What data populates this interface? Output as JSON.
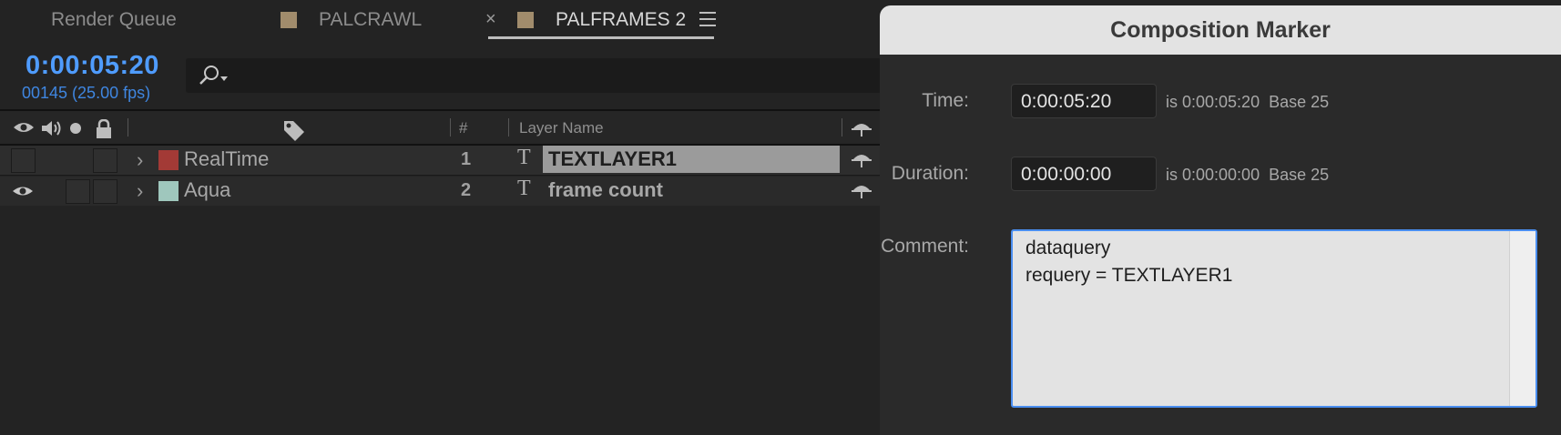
{
  "tabs": {
    "render_queue": "Render Queue",
    "palcrawl": "PALCRAWL",
    "palframes": "PALFRAMES 2",
    "close": "×"
  },
  "timeline": {
    "timecode": "0:00:05:20",
    "frames": "00145 (25.00 fps)"
  },
  "columns": {
    "number": "#",
    "layer_name": "Layer Name"
  },
  "layers": [
    {
      "source": "RealTime",
      "color": "#a33a36",
      "number": "1",
      "type": "T",
      "name": "TEXTLAYER1"
    },
    {
      "source": "Aqua",
      "color": "#9fc7bd",
      "number": "2",
      "type": "T",
      "name": "frame count"
    }
  ],
  "dialog": {
    "title": "Composition Marker",
    "time_label": "Time:",
    "time_value": "0:00:05:20",
    "time_info": "is 0:00:05:20  Base 25",
    "duration_label": "Duration:",
    "duration_value": "0:00:00:00",
    "duration_info": "is 0:00:00:00  Base 25",
    "comment_label": "Comment:",
    "comment_line1": "dataquery",
    "comment_line2": "requery = TEXTLAYER1"
  }
}
